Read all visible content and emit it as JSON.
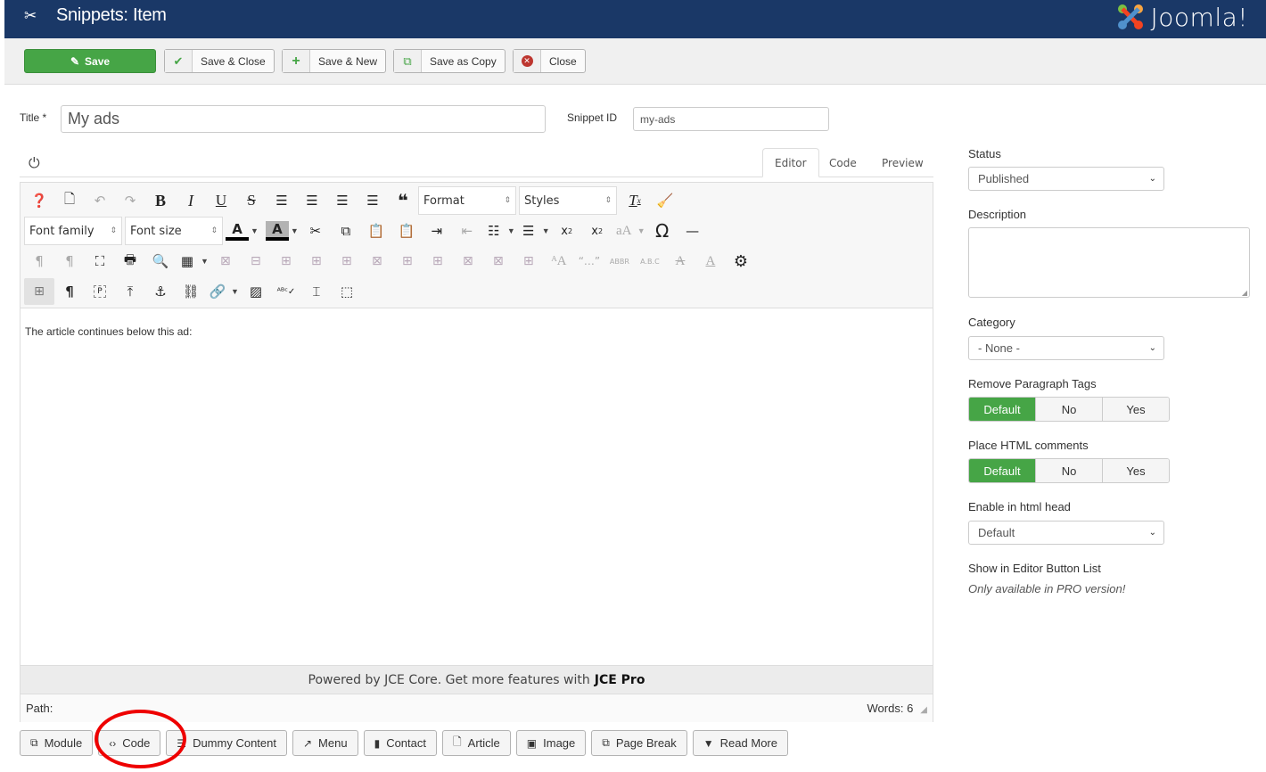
{
  "header": {
    "title": "Snippets: Item",
    "title_icon": "scissors-icon",
    "logo_text": "Joomla!"
  },
  "toolbar": {
    "save": "Save",
    "save_close": "Save & Close",
    "save_new": "Save & New",
    "save_copy": "Save as Copy",
    "close": "Close"
  },
  "form": {
    "title_label": "Title *",
    "title_value": "My ads",
    "snippet_id_label": "Snippet ID",
    "snippet_id_value": "my-ads"
  },
  "editor_tabs": [
    "Editor",
    "Code",
    "Preview"
  ],
  "editor": {
    "format_select": "Format",
    "styles_select": "Styles",
    "font_family_select": "Font family",
    "font_size_select": "Font size",
    "content": "The article continues below this ad:",
    "promo_text": "Powered by JCE Core. Get more features with",
    "promo_bold": "JCE Pro",
    "path_label": "Path:",
    "words": "Words: 6"
  },
  "extra_buttons": [
    {
      "label": "Module",
      "icon": "module-icon",
      "glyph": "⧉"
    },
    {
      "label": "Code",
      "icon": "code-icon",
      "glyph": "‹›"
    },
    {
      "label": "Dummy Content",
      "icon": "list-icon",
      "glyph": "☰"
    },
    {
      "label": "Menu",
      "icon": "share-icon",
      "glyph": "↗"
    },
    {
      "label": "Contact",
      "icon": "address-book-icon",
      "glyph": "▮"
    },
    {
      "label": "Article",
      "icon": "file-add-icon",
      "glyph": "🗋"
    },
    {
      "label": "Image",
      "icon": "image-icon",
      "glyph": "▣"
    },
    {
      "label": "Page Break",
      "icon": "copy-icon",
      "glyph": "⧉"
    },
    {
      "label": "Read More",
      "icon": "chevron-down-icon",
      "glyph": "▼"
    }
  ],
  "sidebar": {
    "status_label": "Status",
    "status_value": "Published",
    "description_label": "Description",
    "category_label": "Category",
    "category_value": "- None -",
    "remove_p_label": "Remove Paragraph Tags",
    "html_comments_label": "Place HTML comments",
    "radio_options": [
      "Default",
      "No",
      "Yes"
    ],
    "html_head_label": "Enable in html head",
    "html_head_value": "Default",
    "editor_list_label": "Show in Editor Button List",
    "pro_note": "Only available in PRO version!"
  },
  "colors": {
    "header_bg": "#1a3867",
    "save_green": "#46a546",
    "highlight_circle": "#e00000"
  }
}
